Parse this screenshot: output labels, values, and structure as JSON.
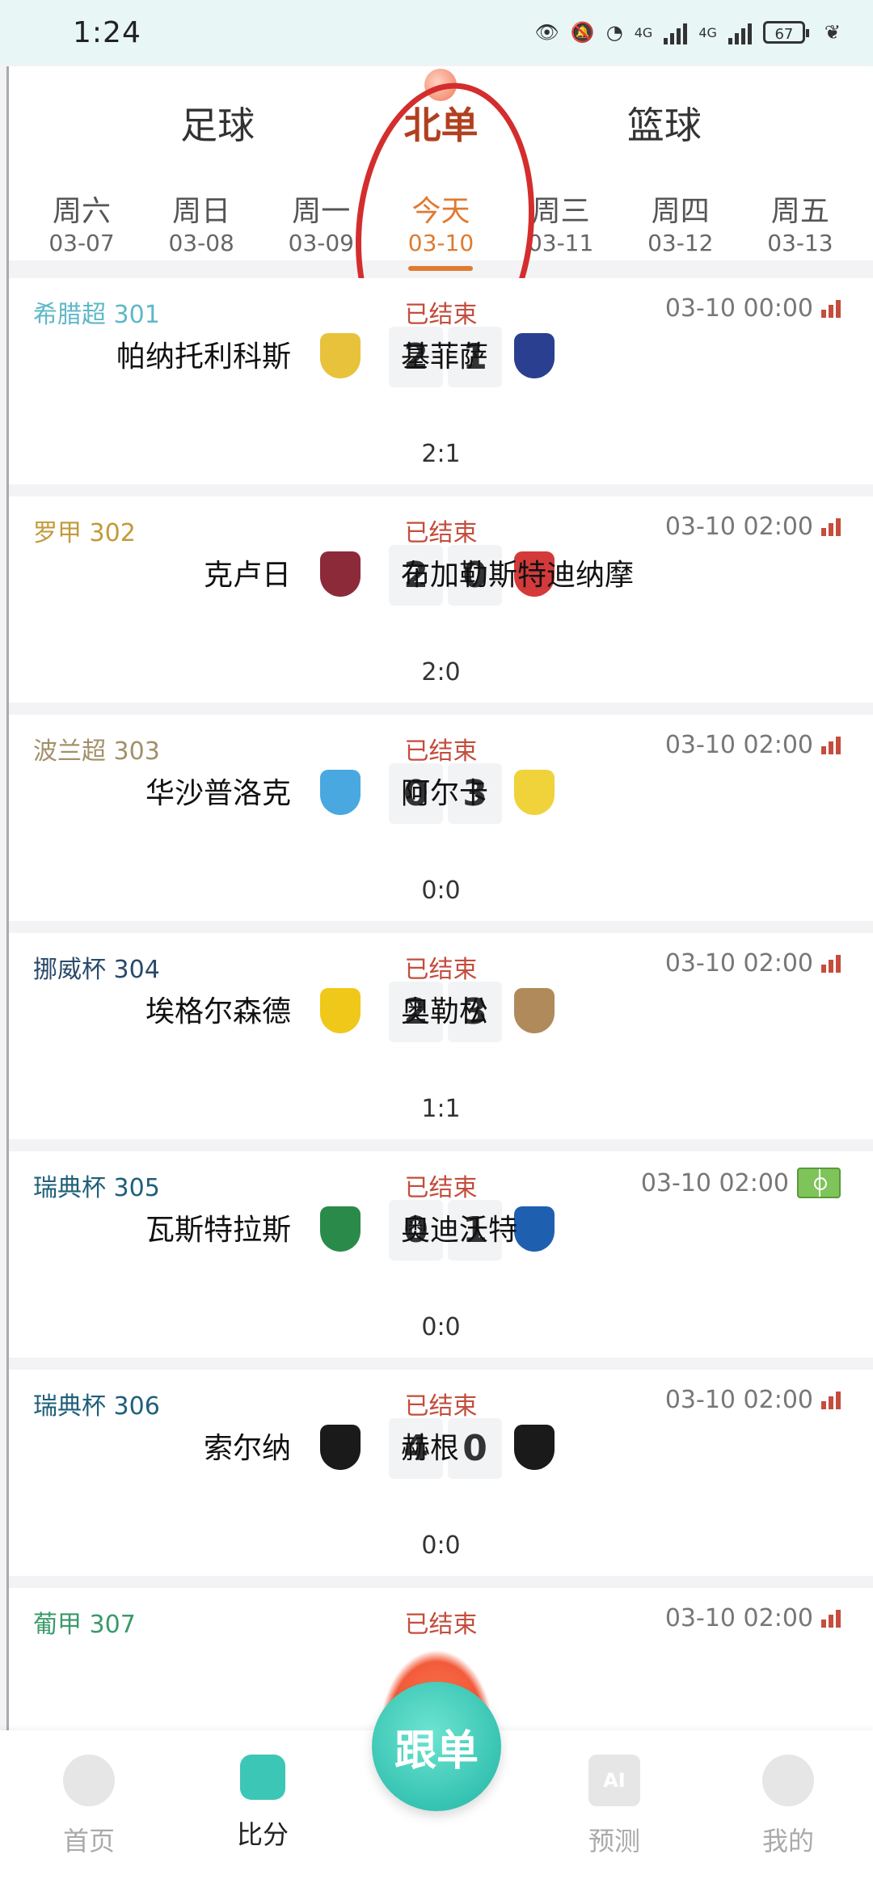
{
  "status_bar": {
    "time": "1:24",
    "battery": "67",
    "net1": "4G",
    "net2": "4G"
  },
  "top_tabs": [
    "足球",
    "北单",
    "篮球"
  ],
  "dates": [
    {
      "weekday": "周六",
      "date": "03-07"
    },
    {
      "weekday": "周日",
      "date": "03-08"
    },
    {
      "weekday": "周一",
      "date": "03-09"
    },
    {
      "weekday": "今天",
      "date": "03-10"
    },
    {
      "weekday": "周三",
      "date": "03-11"
    },
    {
      "weekday": "周四",
      "date": "03-12"
    },
    {
      "weekday": "周五",
      "date": "03-13"
    }
  ],
  "matches": [
    {
      "league": "希腊超 301",
      "league_color": "#5fb8c8",
      "status": "已结束",
      "datetime": "03-10 00:00",
      "home": "帕纳托利科斯",
      "away": "基菲萨",
      "home_score": "2",
      "away_score": "1",
      "half": "2:1",
      "home_logo": "#e8c23a",
      "away_logo": "#2a3f8f",
      "icon": "stats"
    },
    {
      "league": "罗甲    302",
      "league_color": "#c29a3a",
      "status": "已结束",
      "datetime": "03-10 02:00",
      "home": "克卢日",
      "away": "布加勒斯特迪纳摩",
      "home_score": "2",
      "away_score": "0",
      "half": "2:0",
      "home_logo": "#8c2a3a",
      "away_logo": "#d43a3a",
      "icon": "stats"
    },
    {
      "league": "波兰超 303",
      "league_color": "#a3906a",
      "status": "已结束",
      "datetime": "03-10 02:00",
      "home": "华沙普洛克",
      "away": "阿尔卡",
      "home_score": "0",
      "away_score": "3",
      "half": "0:0",
      "home_logo": "#4aa8e0",
      "away_logo": "#f0d23a",
      "icon": "stats"
    },
    {
      "league": "挪威杯 304",
      "league_color": "#2a4a6a",
      "status": "已结束",
      "datetime": "03-10 02:00",
      "home": "埃格尔森德",
      "away": "奥勒松",
      "home_score": "2",
      "away_score": "3",
      "half": "1:1",
      "home_logo": "#f0c81a",
      "away_logo": "#b08a5a",
      "icon": "stats"
    },
    {
      "league": "瑞典杯 305",
      "league_color": "#1f5f7a",
      "status": "已结束",
      "datetime": "03-10 02:00",
      "home": "瓦斯特拉斯",
      "away": "奥迪沃特",
      "home_score": "0",
      "away_score": "1",
      "half": "0:0",
      "home_logo": "#2a8a4a",
      "away_logo": "#1f5fb0",
      "icon": "field"
    },
    {
      "league": "瑞典杯 306",
      "league_color": "#1f5f7a",
      "status": "已结束",
      "datetime": "03-10 02:00",
      "home": "索尔纳",
      "away": "赫根",
      "home_score": "4",
      "away_score": "0",
      "half": "0:0",
      "home_logo": "#1a1a1a",
      "away_logo": "#1a1a1a",
      "icon": "stats"
    }
  ],
  "partial_match": {
    "league": "葡甲    307",
    "league_color": "#3a9a6a",
    "status": "已结束",
    "datetime": "03-10 02:00"
  },
  "fab_label": "跟单",
  "bottom_nav": [
    "首页",
    "比分",
    "预测",
    "我的"
  ],
  "ai_label": "AI",
  "colors": {
    "accent": "#e07a30",
    "teal": "#3cc6b6",
    "status_red": "#c44d3d",
    "circle_red": "#d42d2d"
  }
}
